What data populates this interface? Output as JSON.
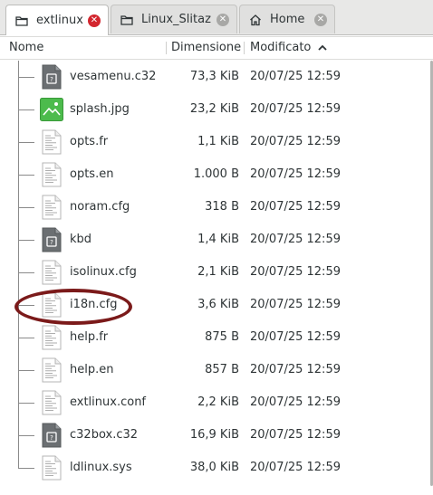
{
  "tabs": [
    {
      "label": "extlinux",
      "active": true,
      "close_icon": "close-circle-red-icon"
    },
    {
      "label": "Linux_Slitaz",
      "active": false,
      "close_icon": "close-circle-grey-icon"
    },
    {
      "label": "Home",
      "active": false,
      "close_icon": "close-circle-grey-icon"
    }
  ],
  "columns": {
    "name": "Nome",
    "size": "Dimensione",
    "modified": "Modificato",
    "sort_icon": "chevron-up-icon"
  },
  "files": [
    {
      "name": "vesamenu.c32",
      "size": "73,3 KiB",
      "modified": "20/07/25 12:59",
      "icon": "binary-file-icon"
    },
    {
      "name": "splash.jpg",
      "size": "23,2 KiB",
      "modified": "20/07/25 12:59",
      "icon": "image-file-icon"
    },
    {
      "name": "opts.fr",
      "size": "1,1 KiB",
      "modified": "20/07/25 12:59",
      "icon": "text-file-icon"
    },
    {
      "name": "opts.en",
      "size": "1.000 B",
      "modified": "20/07/25 12:59",
      "icon": "text-file-icon"
    },
    {
      "name": "noram.cfg",
      "size": "318 B",
      "modified": "20/07/25 12:59",
      "icon": "text-file-icon"
    },
    {
      "name": "kbd",
      "size": "1,4 KiB",
      "modified": "20/07/25 12:59",
      "icon": "binary-file-icon"
    },
    {
      "name": "isolinux.cfg",
      "size": "2,1 KiB",
      "modified": "20/07/25 12:59",
      "icon": "text-file-icon"
    },
    {
      "name": "i18n.cfg",
      "size": "3,6 KiB",
      "modified": "20/07/25 12:59",
      "icon": "text-file-icon"
    },
    {
      "name": "help.fr",
      "size": "875 B",
      "modified": "20/07/25 12:59",
      "icon": "text-file-icon"
    },
    {
      "name": "help.en",
      "size": "857 B",
      "modified": "20/07/25 12:59",
      "icon": "text-file-icon"
    },
    {
      "name": "extlinux.conf",
      "size": "2,2 KiB",
      "modified": "20/07/25 12:59",
      "icon": "text-file-icon"
    },
    {
      "name": "c32box.c32",
      "size": "16,9 KiB",
      "modified": "20/07/25 12:59",
      "icon": "binary-file-icon"
    },
    {
      "name": "ldlinux.sys",
      "size": "38,0 KiB",
      "modified": "20/07/25 12:59",
      "icon": "text-file-icon"
    }
  ],
  "colors": {
    "accent_close": "#d3262e",
    "highlight_ellipse": "#7b1a1a",
    "image_icon": "#4cbb4c"
  }
}
